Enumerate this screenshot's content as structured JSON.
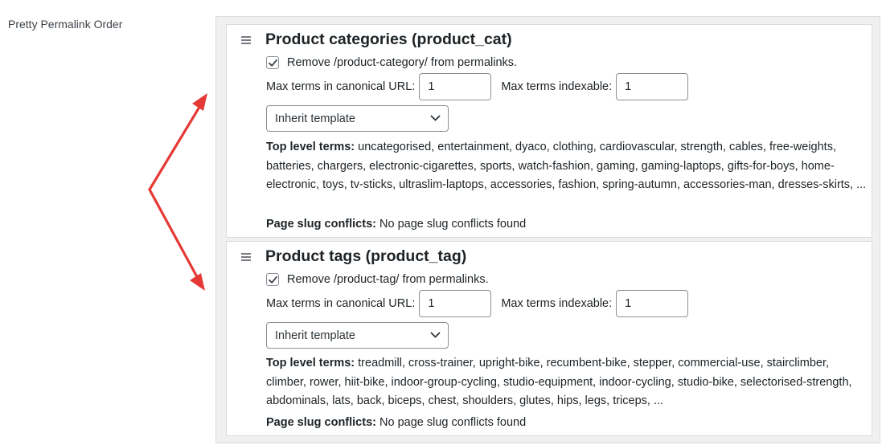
{
  "row_label": "Pretty Permalink Order",
  "taxonomies": [
    {
      "title": "Product categories (product_cat)",
      "remove_label": "Remove /product-category/ from permalinks.",
      "remove_checked": true,
      "max_canonical_label": "Max terms in canonical URL:",
      "max_canonical_value": "1",
      "max_indexable_label": "Max terms indexable:",
      "max_indexable_value": "1",
      "template_selected": "Inherit template",
      "top_terms_label": "Top level terms:",
      "top_terms": "uncategorised, entertainment, dyaco, clothing, cardiovascular, strength, cables, free-weights, batteries, chargers, electronic-cigarettes, sports, watch-fashion, gaming, gaming-laptops, gifts-for-boys, home-electronic, toys, tv-sticks, ultraslim-laptops, accessories, fashion, spring-autumn, accessories-man, dresses-skirts, ...",
      "conflicts_label": "Page slug conflicts:",
      "conflicts_value": "No page slug conflicts found"
    },
    {
      "title": "Product tags (product_tag)",
      "remove_label": "Remove /product-tag/ from permalinks.",
      "remove_checked": true,
      "max_canonical_label": "Max terms in canonical URL:",
      "max_canonical_value": "1",
      "max_indexable_label": "Max terms indexable:",
      "max_indexable_value": "1",
      "template_selected": "Inherit template",
      "top_terms_label": "Top level terms:",
      "top_terms": "treadmill, cross-trainer, upright-bike, recumbent-bike, stepper, commercial-use, stairclimber, climber, rower, hiit-bike, indoor-group-cycling, studio-equipment, indoor-cycling, studio-bike, selectorised-strength, abdominals, lats, back, biceps, chest, shoulders, glutes, hips, legs, triceps, ...",
      "conflicts_label": "Page slug conflicts:",
      "conflicts_value": "No page slug conflicts found"
    }
  ],
  "colors": {
    "arrow": "#e53935",
    "check": "#3c434a"
  }
}
